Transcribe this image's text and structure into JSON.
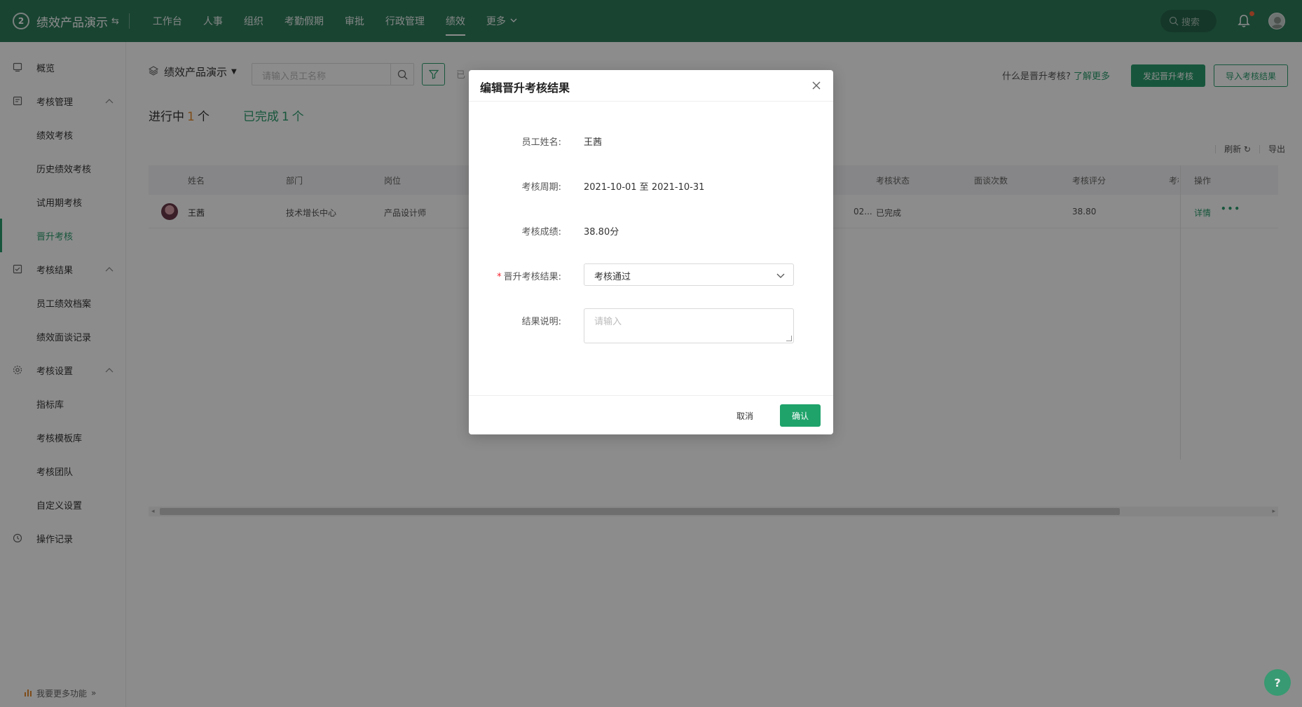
{
  "topbar": {
    "logo_text": "2",
    "brand": "绩效产品演示",
    "switch_icon": "swap-icon",
    "nav": [
      {
        "label": "工作台"
      },
      {
        "label": "人事"
      },
      {
        "label": "组织"
      },
      {
        "label": "考勤假期"
      },
      {
        "label": "审批"
      },
      {
        "label": "行政管理"
      },
      {
        "label": "绩效",
        "active": true
      },
      {
        "label": "更多"
      }
    ],
    "search_placeholder": "搜索"
  },
  "sidebar": {
    "items": [
      {
        "label": "概览",
        "icon": "overview-icon"
      },
      {
        "label": "考核管理",
        "icon": "manage-icon",
        "expanded": true
      },
      {
        "label": "绩效考核"
      },
      {
        "label": "历史绩效考核"
      },
      {
        "label": "试用期考核"
      },
      {
        "label": "晋升考核",
        "active": true
      },
      {
        "label": "考核结果",
        "icon": "result-icon",
        "expanded": true
      },
      {
        "label": "员工绩效档案"
      },
      {
        "label": "绩效面谈记录"
      },
      {
        "label": "考核设置",
        "icon": "settings-icon",
        "expanded": true
      },
      {
        "label": "指标库"
      },
      {
        "label": "考核模板库"
      },
      {
        "label": "考核团队"
      },
      {
        "label": "自定义设置"
      },
      {
        "label": "操作记录",
        "icon": "history-icon"
      }
    ],
    "footer": "我要更多功能"
  },
  "main": {
    "org_selector": "绩效产品演示",
    "employee_search_placeholder": "请输入员工名称",
    "filter_trailing": "已",
    "whatis": "什么是晋升考核?",
    "learn_more": "了解更多",
    "start_button": "发起晋升考核",
    "import_button": "导入考核结果",
    "tabs": {
      "in_progress_label": "进行中",
      "in_progress_count": "1",
      "done_label": "已完成",
      "done_count": "1",
      "unit": "个"
    },
    "refresh": "刷新",
    "export": "导出",
    "table": {
      "headers": [
        "姓名",
        "部门",
        "岗位",
        "考核状态",
        "面谈次数",
        "考核评分",
        "考核",
        "操作"
      ],
      "rows": [
        {
          "name": "王茜",
          "dept": "技术增长中心",
          "position": "产品设计师",
          "date_trunc": "02...",
          "status": "已完成",
          "interviews": "",
          "score": "38.80",
          "detail": "详情",
          "more": "•••"
        }
      ]
    }
  },
  "modal": {
    "title": "编辑晋升考核结果",
    "fields": {
      "name_label": "员工姓名:",
      "name_value": "王茜",
      "period_label": "考核周期:",
      "period_value": "2021-10-01 至 2021-10-31",
      "score_label": "考核成绩:",
      "score_value": "38.80分",
      "result_label": "晋升考核结果:",
      "result_value": "考核通过",
      "desc_label": "结果说明:",
      "desc_placeholder": "请输入"
    },
    "cancel": "取消",
    "confirm": "确认"
  },
  "help": "?"
}
